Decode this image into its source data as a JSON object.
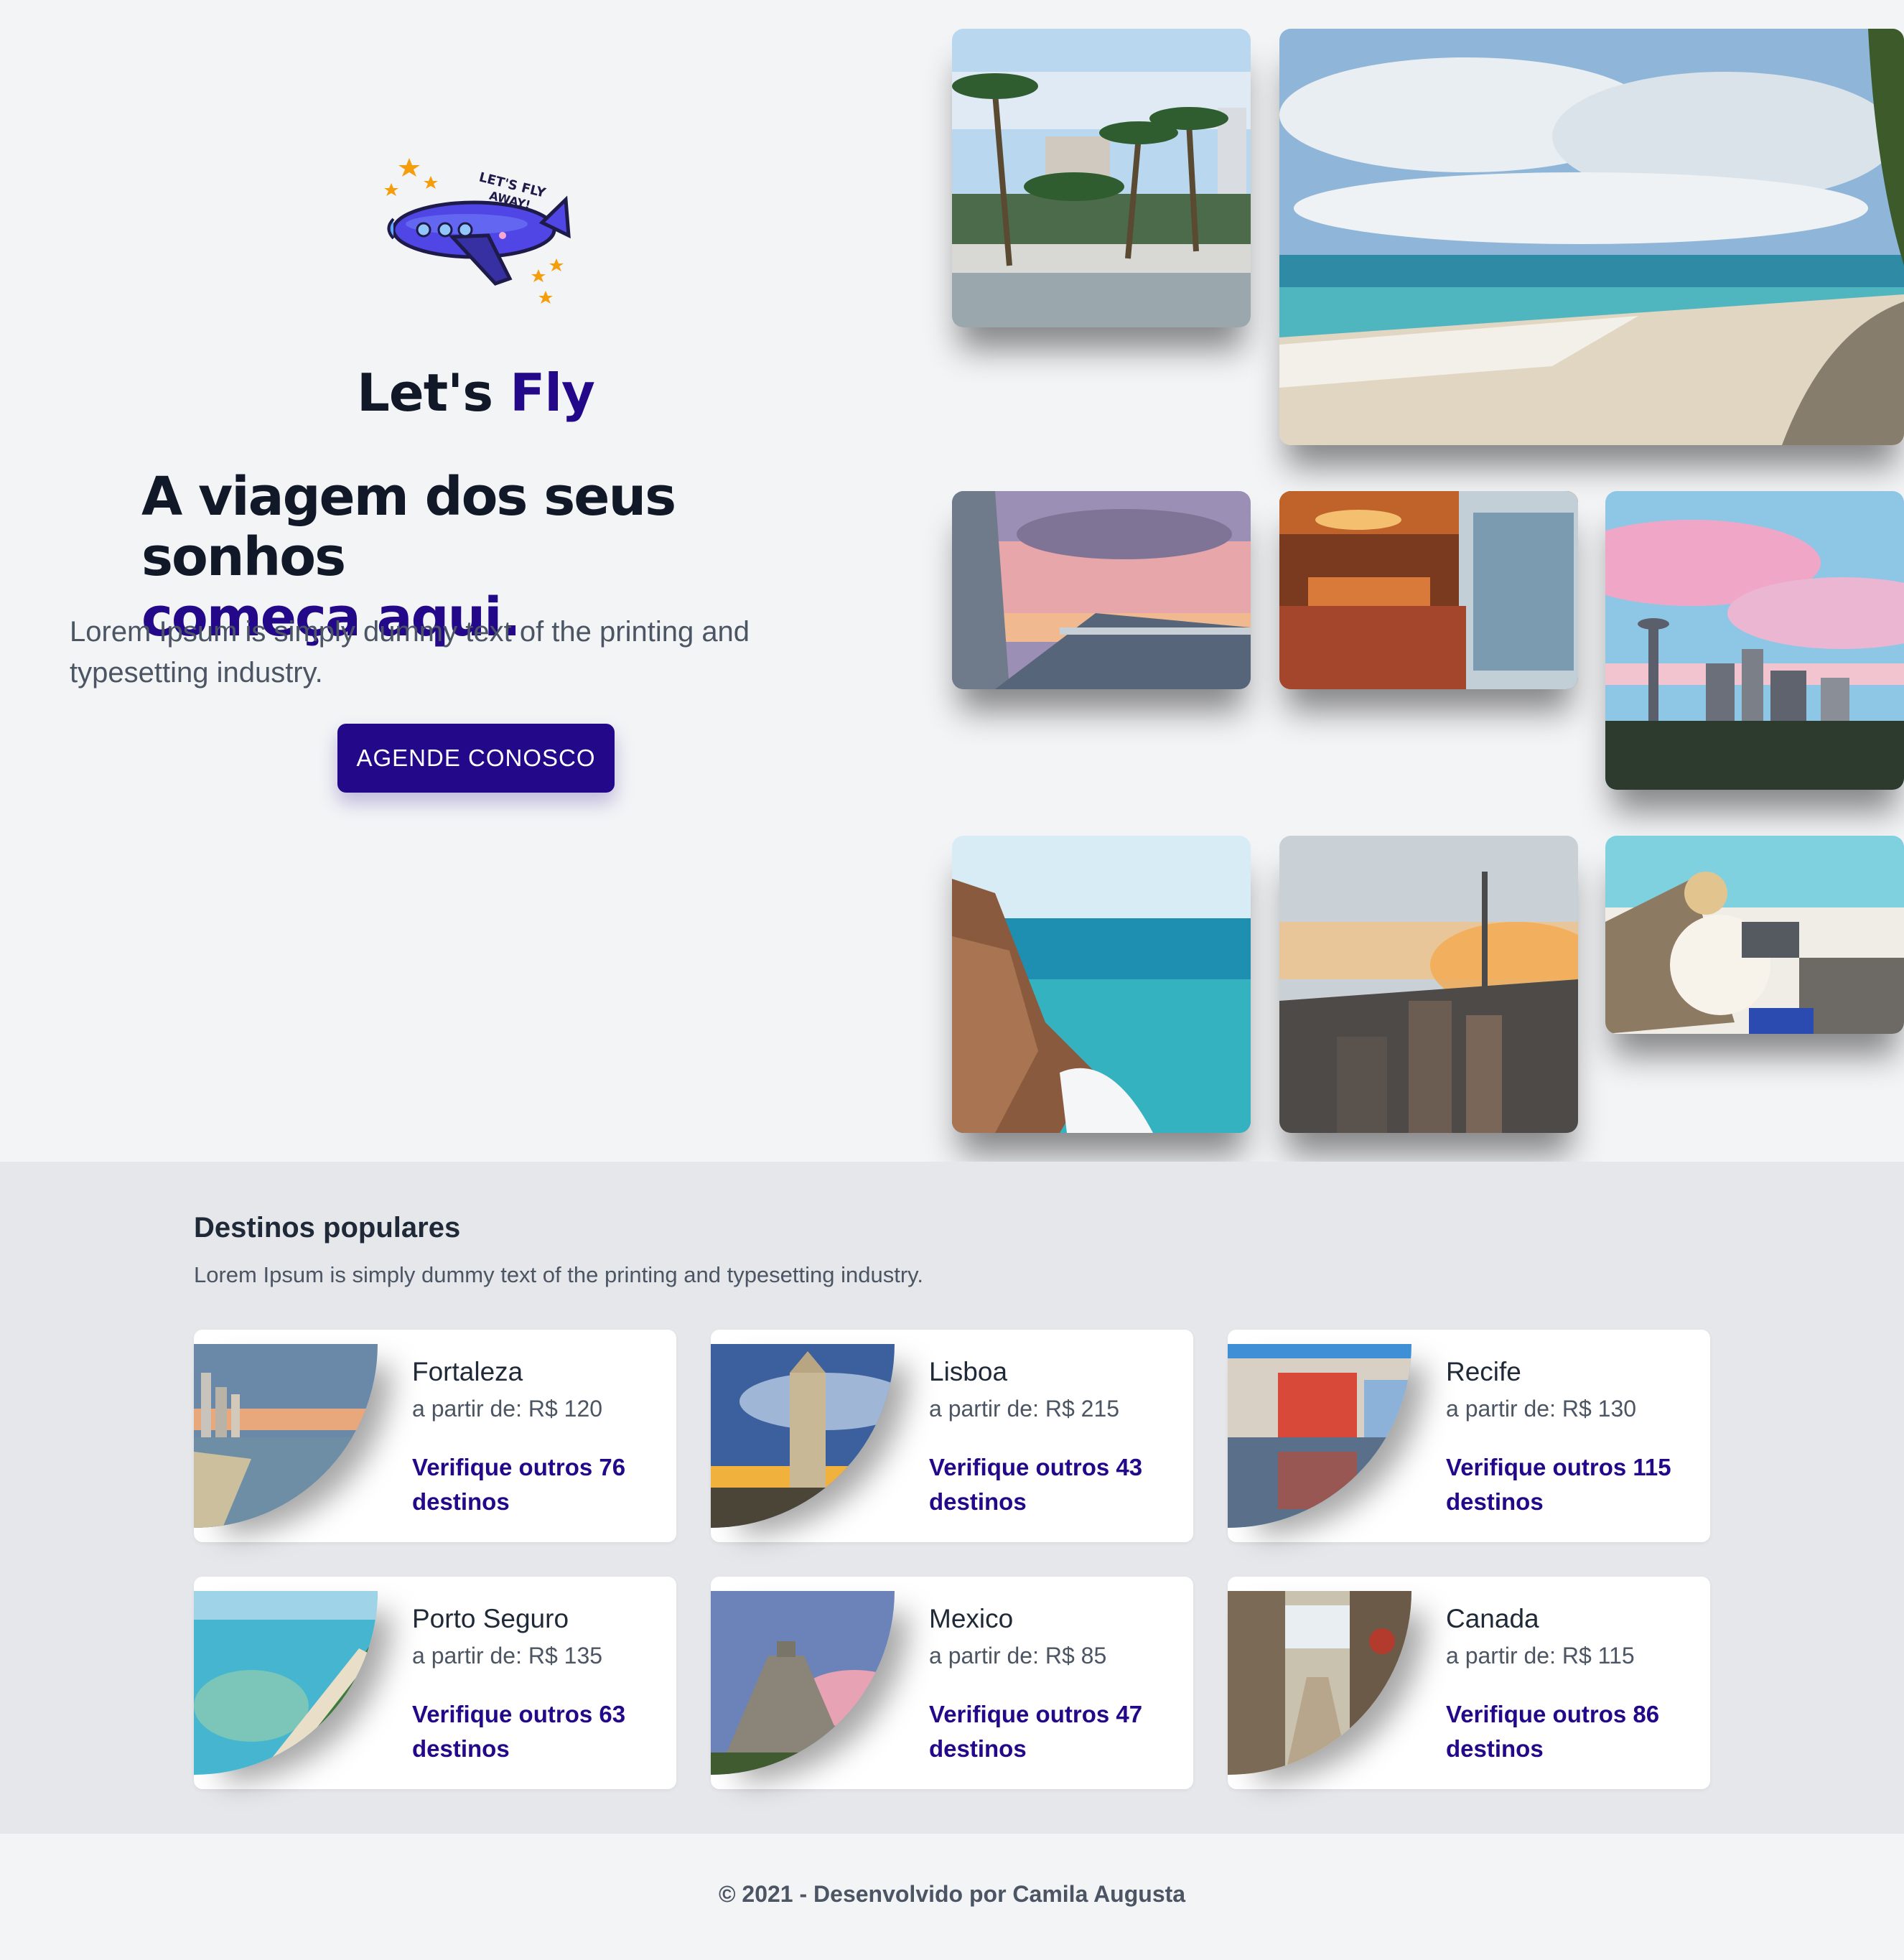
{
  "hero": {
    "logo_text": "LET'S FLY AWAY!",
    "brand_prefix": "Let's",
    "brand_accent": "Fly",
    "headline_line1": "A viagem dos seus sonhos",
    "headline_line2": "começa aqui.",
    "description": "Lorem Ipsum is simply dummy text of the printing and typesetting industry.",
    "cta_label": "AGENDE CONOSCO"
  },
  "popular": {
    "title": "Destinos populares",
    "subtitle": "Lorem Ipsum is simply dummy text of the printing and typesetting industry.",
    "destinations": [
      {
        "city": "Fortaleza",
        "price": "a partir de: R$ 120",
        "more": "Verifique outros 76 destinos"
      },
      {
        "city": "Lisboa",
        "price": "a partir de: R$ 215",
        "more": "Verifique outros 43 destinos"
      },
      {
        "city": "Recife",
        "price": "a partir de: R$ 130",
        "more": "Verifique outros 115 destinos"
      },
      {
        "city": "Porto Seguro",
        "price": "a partir de: R$ 135",
        "more": "Verifique outros 63 destinos"
      },
      {
        "city": "Mexico",
        "price": "a partir de: R$ 85",
        "more": "Verifique outros 47 destinos"
      },
      {
        "city": "Canada",
        "price": "a partir de: R$ 115",
        "more": "Verifique outros 86 destinos"
      }
    ]
  },
  "footer": {
    "copyright": "© 2021 - Desenvolvido por Camila Augusta"
  },
  "colors": {
    "accent": "#23088a",
    "background": "#f3f4f6",
    "section_background": "#e5e7eb"
  }
}
